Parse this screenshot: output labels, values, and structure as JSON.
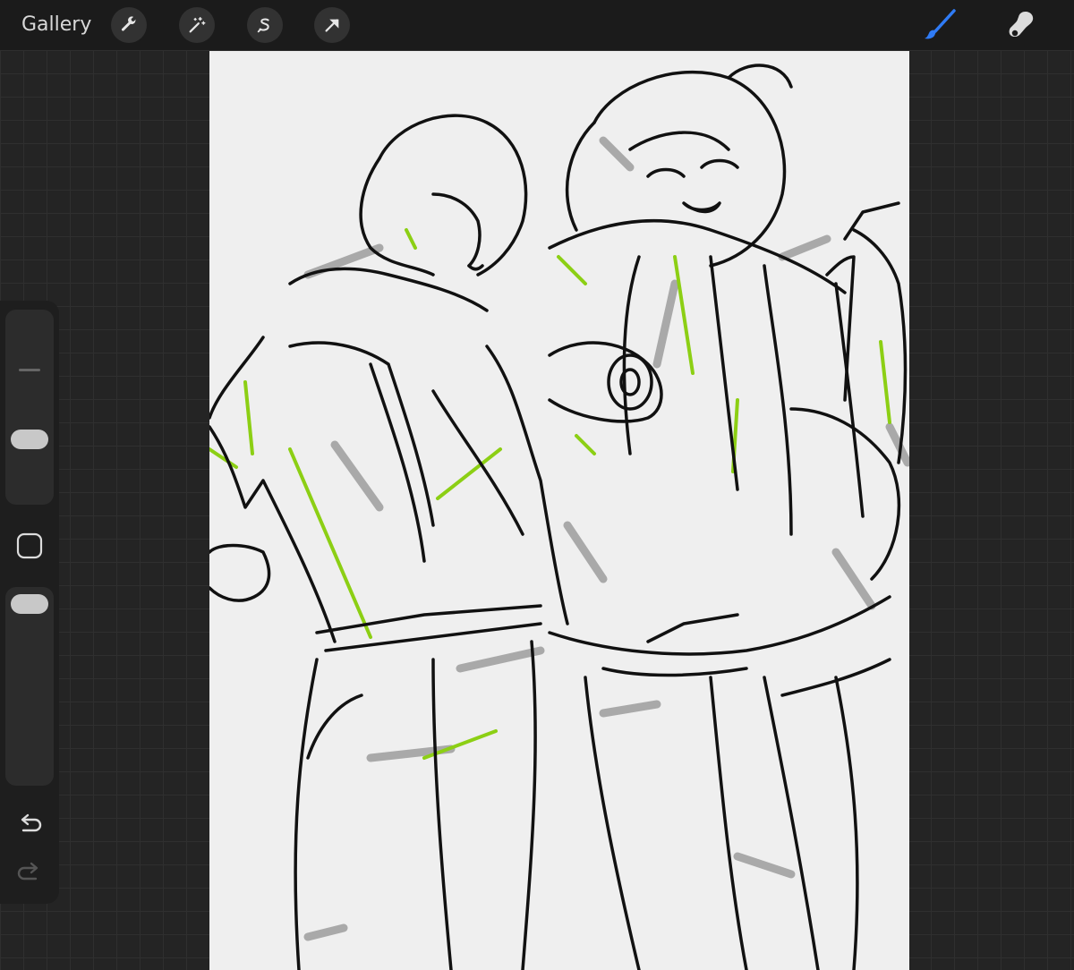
{
  "toolbar": {
    "gallery_label": "Gallery",
    "left_tools": [
      "wrench-icon",
      "magic-wand-icon",
      "selection-icon",
      "transform-arrow-icon"
    ],
    "right_tools": [
      "brush-icon",
      "smudge-icon"
    ],
    "active_tool": "brush-icon",
    "accent_color": "#2f7bf5"
  },
  "sidebar": {
    "size_slider_value": 0.15,
    "opacity_slider_value": 0.08,
    "buttons": [
      "modify-square-icon",
      "undo-icon",
      "redo-icon"
    ]
  },
  "canvas": {
    "background": "#efefef",
    "stroke_colors": [
      "#111111",
      "#a8a8a8",
      "#8ccf14"
    ]
  }
}
